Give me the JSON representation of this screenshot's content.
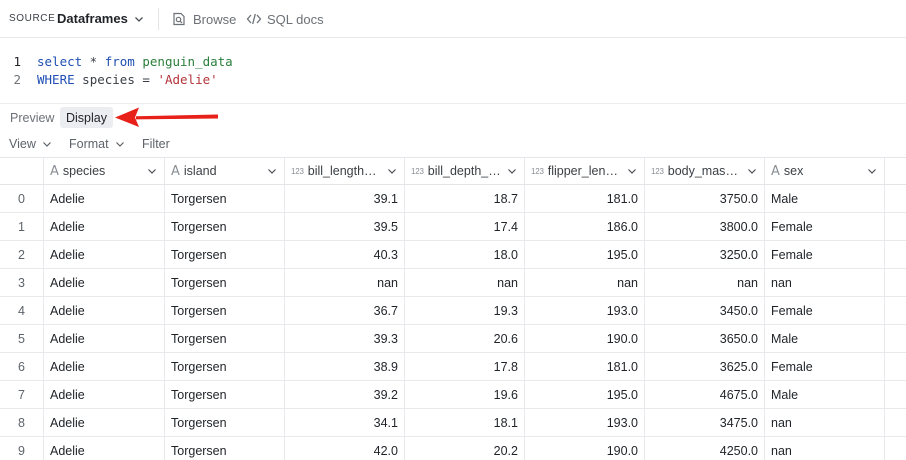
{
  "toolbar": {
    "source_label": "SOURCE",
    "source_value": "Dataframes",
    "browse_label": "Browse",
    "sql_docs_label": "SQL docs"
  },
  "editor": {
    "lines": [
      {
        "number": "1",
        "tokens": [
          {
            "text": "select",
            "kind": "kw"
          },
          {
            "text": " * ",
            "kind": "plain"
          },
          {
            "text": "from",
            "kind": "kw"
          },
          {
            "text": " penguin_data",
            "kind": "ident"
          }
        ]
      },
      {
        "number": "2",
        "tokens": [
          {
            "text": "WHERE",
            "kind": "kw"
          },
          {
            "text": " species = ",
            "kind": "plain"
          },
          {
            "text": "'Adelie'",
            "kind": "str"
          }
        ]
      }
    ]
  },
  "tabs": {
    "preview": "Preview",
    "display": "Display",
    "active": "display"
  },
  "view_controls": {
    "view": "View",
    "format": "Format",
    "filter": "Filter"
  },
  "table": {
    "columns": [
      {
        "key": "species",
        "label": "species",
        "type": "text"
      },
      {
        "key": "island",
        "label": "island",
        "type": "text"
      },
      {
        "key": "bill_length",
        "label": "bill_length_…",
        "type": "number"
      },
      {
        "key": "bill_depth",
        "label": "bill_depth_…",
        "type": "number"
      },
      {
        "key": "flipper_length",
        "label": "flipper_leng…",
        "type": "number"
      },
      {
        "key": "body_mass",
        "label": "body_mass_g",
        "type": "number"
      },
      {
        "key": "sex",
        "label": "sex",
        "type": "text"
      }
    ],
    "type_badge_text": "A",
    "type_badge_number": "123",
    "rows": [
      {
        "index": "0",
        "cells": [
          "Adelie",
          "Torgersen",
          "39.1",
          "18.7",
          "181.0",
          "3750.0",
          "Male"
        ]
      },
      {
        "index": "1",
        "cells": [
          "Adelie",
          "Torgersen",
          "39.5",
          "17.4",
          "186.0",
          "3800.0",
          "Female"
        ]
      },
      {
        "index": "2",
        "cells": [
          "Adelie",
          "Torgersen",
          "40.3",
          "18.0",
          "195.0",
          "3250.0",
          "Female"
        ]
      },
      {
        "index": "3",
        "cells": [
          "Adelie",
          "Torgersen",
          "nan",
          "nan",
          "nan",
          "nan",
          "nan"
        ]
      },
      {
        "index": "4",
        "cells": [
          "Adelie",
          "Torgersen",
          "36.7",
          "19.3",
          "193.0",
          "3450.0",
          "Female"
        ]
      },
      {
        "index": "5",
        "cells": [
          "Adelie",
          "Torgersen",
          "39.3",
          "20.6",
          "190.0",
          "3650.0",
          "Male"
        ]
      },
      {
        "index": "6",
        "cells": [
          "Adelie",
          "Torgersen",
          "38.9",
          "17.8",
          "181.0",
          "3625.0",
          "Female"
        ]
      },
      {
        "index": "7",
        "cells": [
          "Adelie",
          "Torgersen",
          "39.2",
          "19.6",
          "195.0",
          "4675.0",
          "Male"
        ]
      },
      {
        "index": "8",
        "cells": [
          "Adelie",
          "Torgersen",
          "34.1",
          "18.1",
          "193.0",
          "3475.0",
          "nan"
        ]
      },
      {
        "index": "9",
        "cells": [
          "Adelie",
          "Torgersen",
          "42.0",
          "20.2",
          "190.0",
          "4250.0",
          "nan"
        ]
      }
    ]
  },
  "colors": {
    "accent_arrow": "#e8201a",
    "keyword": "#1f4fb3",
    "identifier": "#2a7f3c",
    "string": "#b3343b",
    "active_tab_bg": "#ebedf0"
  }
}
